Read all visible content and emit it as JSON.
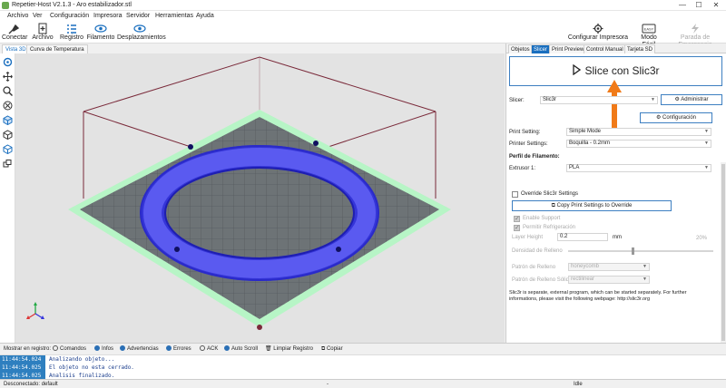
{
  "window": {
    "title": "Repetier-Host V2.1.3 - Aro estabilizador.stl",
    "controls": [
      "—",
      "☐",
      "✕"
    ]
  },
  "menu": [
    "Archivo",
    "Ver",
    "Configuración",
    "Impresora",
    "Servidor",
    "Herramientas",
    "Ayuda"
  ],
  "toolbar": {
    "connect": "Conectar",
    "file": "Archivo",
    "log": "Registro",
    "filament": "Filamento",
    "travel": "Desplazamientos",
    "printer_config": "Configurar Impresora",
    "easy_mode": "Modo Fácil",
    "easy_badge": "EASY",
    "emergency": "Parada de Emergencia"
  },
  "view_tabs": [
    "Vista 3D",
    "Curva de Temperatura"
  ],
  "right_tabs": [
    "Objetos",
    "Slicer",
    "Print Preview",
    "Control Manual",
    "Tarjeta SD"
  ],
  "slicer_panel": {
    "slice_button": "Slice con Slic3r",
    "slicer_label": "Slicer:",
    "slicer_value": "Slic3r",
    "manage_button": "Administrar",
    "config_button": "Configuración",
    "print_setting_label": "Print Setting:",
    "print_setting_value": "Simple Mode",
    "printer_settings_label": "Printer Settings:",
    "printer_settings_value": "Boquilla - 0.2mm",
    "filament_profile_heading": "Perfil de Filamento:",
    "extruder_label": "Extrusor 1:",
    "extruder_value": "PLA",
    "override_label": "Override Slic3r Settings",
    "copy_button": "Copy Print Settings to Override",
    "enable_support": "Enable Support",
    "cooling": "Permitir Refrigeración",
    "layer_height_label": "Layer Height",
    "layer_height_value": "0.2",
    "layer_height_unit": "mm",
    "infill_label": "Densidad de Relleno",
    "infill_value": "20%",
    "infill_fraction": 0.2,
    "infill_pattern_label": "Patrón de Relleno",
    "infill_pattern_value": "honeycomb",
    "solid_pattern_label": "Patrón de Relleno Sólido",
    "solid_pattern_value": "rectilinear",
    "info_text": "Slic3r is separate, external program, which can be started separately. For further informations, please visit the following webpage: http://slic3r.org"
  },
  "log_bar": {
    "show_label": "Mostrar en registro:",
    "filters": [
      {
        "label": "Comandos",
        "on": false
      },
      {
        "label": "Infos",
        "on": true
      },
      {
        "label": "Advertencias",
        "on": true
      },
      {
        "label": "Errores",
        "on": true
      },
      {
        "label": "ACK",
        "on": false
      },
      {
        "label": "Auto Scroll",
        "on": true
      }
    ],
    "clear": "Limpiar Registro",
    "copy": "Copiar"
  },
  "log": [
    {
      "time": "11:44:54.024",
      "message": "Analizando objeto..."
    },
    {
      "time": "11:44:54.025",
      "message": "El objeto no esta cerrado."
    },
    {
      "time": "11:44:54.025",
      "message": "Analisis finalizado."
    }
  ],
  "status": {
    "connection": "Desconectado: default",
    "dash": "-",
    "idle": "Idle"
  },
  "colors": {
    "accent": "#1a6fbf",
    "ring": "#4a4ae8",
    "bed_grid": "#6d7376",
    "bed_border": "#aef0c0",
    "build_volume": "#7a2a3a",
    "arrow": "#f07a18",
    "log_timestamp": "#2e7fbf"
  }
}
